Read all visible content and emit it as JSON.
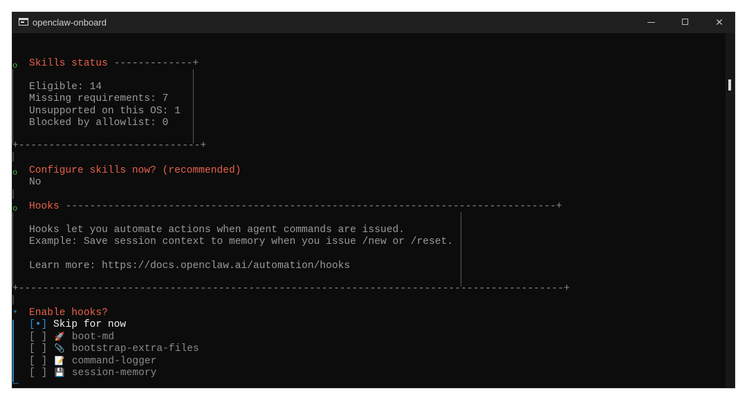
{
  "window": {
    "title": "openclaw-onboard",
    "minimize_label": "minimize",
    "maximize_label": "maximize",
    "close_glyph": "✕"
  },
  "skills": {
    "heading": "Skills status",
    "dashes": "-------------+",
    "eligible": "Eligible: 14",
    "missing": "Missing requirements: 7",
    "unsupported": "Unsupported on this OS: 1",
    "blocked": "Blocked by allowlist: 0",
    "bottom_border": "+------------------------------+"
  },
  "configure": {
    "prompt": "Configure skills now? (recommended)",
    "answer": "No"
  },
  "hooks": {
    "heading": "Hooks",
    "dashes": "---------------------------------------------------------------------------------+",
    "line1": "Hooks let you automate actions when agent commands are issued.",
    "line2": "Example: Save session context to memory when you issue /new or /reset.",
    "line3": "Learn more: https://docs.openclaw.ai/automation/hooks",
    "bottom_border": "+------------------------------------------------------------------------------------------+"
  },
  "enable_hooks": {
    "prompt": "Enable hooks?",
    "options": [
      {
        "checkbox": "[•]",
        "icon": "",
        "label": "Skip for now",
        "selected": true
      },
      {
        "checkbox": "[ ]",
        "icon": "🚀",
        "label": "boot-md",
        "selected": false
      },
      {
        "checkbox": "[ ]",
        "icon": "📎",
        "label": "bootstrap-extra-files",
        "selected": false
      },
      {
        "checkbox": "[ ]",
        "icon": "📝",
        "label": "command-logger",
        "selected": false
      },
      {
        "checkbox": "[ ]",
        "icon": "💾",
        "label": "session-memory",
        "selected": false
      }
    ],
    "footer": "—"
  },
  "markers": {
    "done": "o",
    "active": "*"
  },
  "colors": {
    "background": "#0c0c0c",
    "heading": "#e8604a",
    "text": "#9a9a9a",
    "done_marker": "#46b946",
    "active_marker": "#2f8fd8"
  }
}
